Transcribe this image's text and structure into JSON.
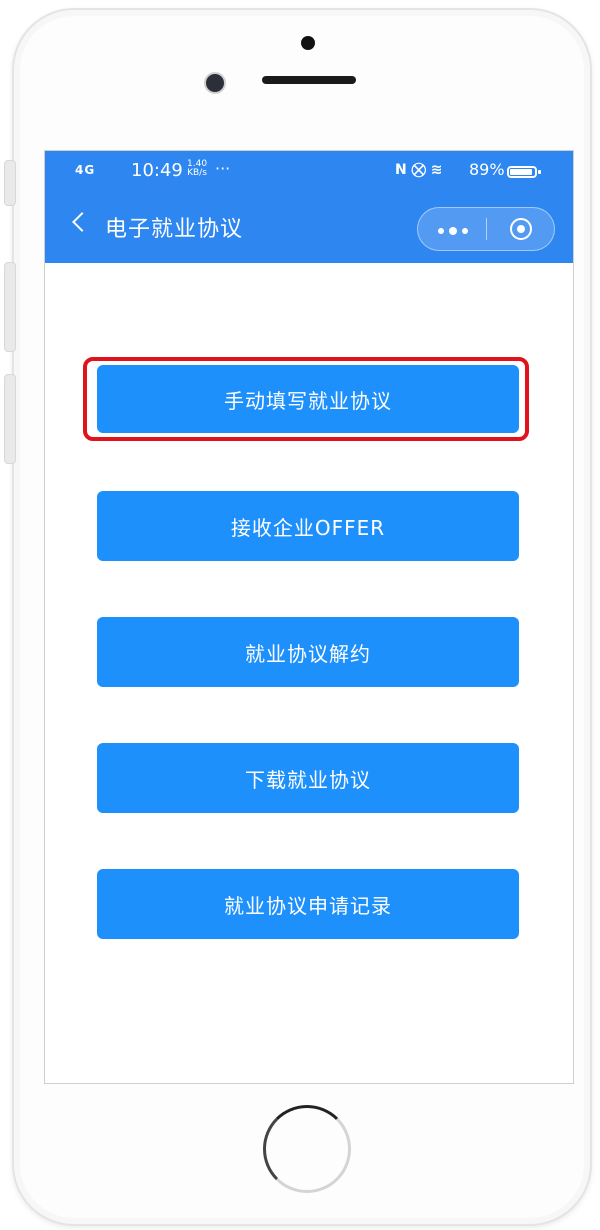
{
  "status_bar": {
    "signal": "4G",
    "time": "10:49",
    "speed_value": "1.40",
    "speed_unit": "KB/s",
    "more": "···",
    "icons": "N ⛒ ≋",
    "battery": "89%"
  },
  "nav": {
    "back_icon": "chevron-left-icon",
    "title": "电子就业协议",
    "more_icon": "more-dots-icon",
    "close_icon": "miniprogram-close-icon"
  },
  "colors": {
    "header_blue": "#2e86f0",
    "button_blue": "#1e90fc",
    "highlight_red": "#e0121c"
  },
  "menu": {
    "items": [
      {
        "label": "手动填写就业协议",
        "highlighted": true
      },
      {
        "label": "接收企业OFFER"
      },
      {
        "label": "就业协议解约"
      },
      {
        "label": "下载就业协议"
      },
      {
        "label": "就业协议申请记录"
      }
    ]
  }
}
